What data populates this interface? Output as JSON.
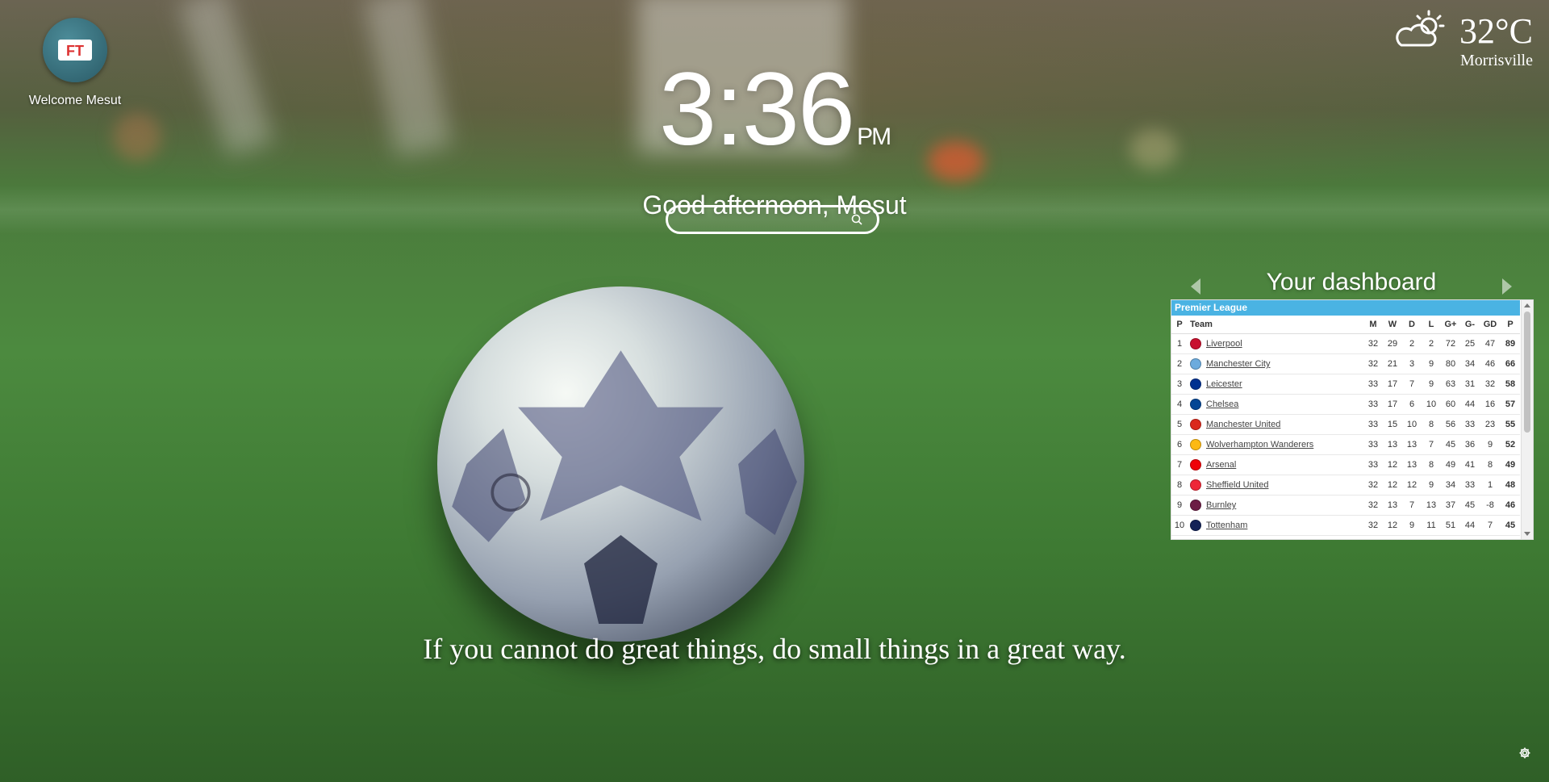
{
  "profile": {
    "logo_text": "FT",
    "welcome": "Welcome Mesut"
  },
  "clock": {
    "time": "3:36",
    "ampm": "PM",
    "greeting": "Good afternoon, Mesut"
  },
  "search": {
    "placeholder": "",
    "icon": "search-icon"
  },
  "weather": {
    "icon": "partly-cloudy-icon",
    "temperature": "32°C",
    "city": "Morrisville"
  },
  "dashboard": {
    "title": "Your dashboard",
    "league": "Premier League",
    "columns": [
      "P",
      "Team",
      "M",
      "W",
      "D",
      "L",
      "G+",
      "G-",
      "GD",
      "P"
    ],
    "rows": [
      {
        "pos": "1",
        "team": "Liverpool",
        "crest": "#c8102e",
        "m": "32",
        "w": "29",
        "d": "2",
        "l": "2",
        "gf": "72",
        "ga": "25",
        "gd": "47",
        "pts": "89"
      },
      {
        "pos": "2",
        "team": "Manchester City",
        "crest": "#6cabdd",
        "m": "32",
        "w": "21",
        "d": "3",
        "l": "9",
        "gf": "80",
        "ga": "34",
        "gd": "46",
        "pts": "66"
      },
      {
        "pos": "3",
        "team": "Leicester",
        "crest": "#003090",
        "m": "33",
        "w": "17",
        "d": "7",
        "l": "9",
        "gf": "63",
        "ga": "31",
        "gd": "32",
        "pts": "58"
      },
      {
        "pos": "4",
        "team": "Chelsea",
        "crest": "#034694",
        "m": "33",
        "w": "17",
        "d": "6",
        "l": "10",
        "gf": "60",
        "ga": "44",
        "gd": "16",
        "pts": "57"
      },
      {
        "pos": "5",
        "team": "Manchester United",
        "crest": "#da291c",
        "m": "33",
        "w": "15",
        "d": "10",
        "l": "8",
        "gf": "56",
        "ga": "33",
        "gd": "23",
        "pts": "55"
      },
      {
        "pos": "6",
        "team": "Wolverhampton Wanderers",
        "crest": "#fdb913",
        "m": "33",
        "w": "13",
        "d": "13",
        "l": "7",
        "gf": "45",
        "ga": "36",
        "gd": "9",
        "pts": "52"
      },
      {
        "pos": "7",
        "team": "Arsenal",
        "crest": "#ef0107",
        "m": "33",
        "w": "12",
        "d": "13",
        "l": "8",
        "gf": "49",
        "ga": "41",
        "gd": "8",
        "pts": "49"
      },
      {
        "pos": "8",
        "team": "Sheffield United",
        "crest": "#ee2737",
        "m": "32",
        "w": "12",
        "d": "12",
        "l": "9",
        "gf": "34",
        "ga": "33",
        "gd": "1",
        "pts": "48"
      },
      {
        "pos": "9",
        "team": "Burnley",
        "crest": "#6c1d45",
        "m": "32",
        "w": "13",
        "d": "7",
        "l": "13",
        "gf": "37",
        "ga": "45",
        "gd": "-8",
        "pts": "46"
      },
      {
        "pos": "10",
        "team": "Tottenham",
        "crest": "#132257",
        "m": "32",
        "w": "12",
        "d": "9",
        "l": "11",
        "gf": "51",
        "ga": "44",
        "gd": "7",
        "pts": "45"
      }
    ]
  },
  "quote": "If you cannot do great things, do small things in a great way.",
  "settings": {
    "icon": "gear-icon"
  }
}
